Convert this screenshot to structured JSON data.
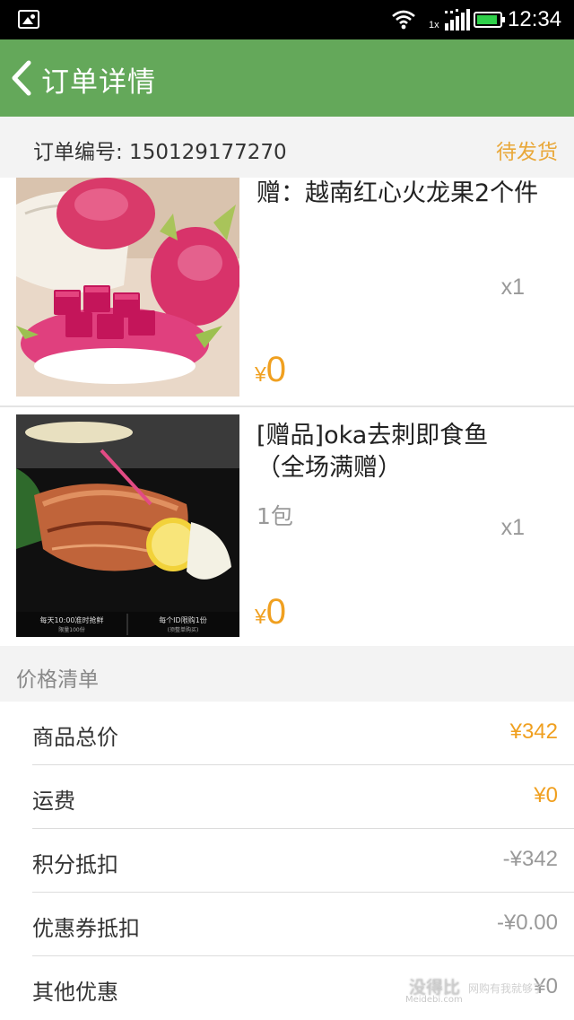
{
  "status_bar": {
    "time": "12:34",
    "network_label": "1x",
    "icons": [
      "image-notification-icon",
      "wifi-icon",
      "signal-icon",
      "battery-icon"
    ]
  },
  "header": {
    "title": "订单详情",
    "back_icon": "chevron-left-icon"
  },
  "order": {
    "number_label": "订单编号: 150129177270",
    "status": "待发货"
  },
  "products": [
    {
      "name": "赠：越南红心火龙果2个件",
      "spec": "",
      "quantity": "x1",
      "currency": "¥",
      "price": "0"
    },
    {
      "name": "[赠品]oka去刺即食鱼（全场满赠）",
      "spec": "1包",
      "quantity": "x1",
      "currency": "¥",
      "price": "0",
      "image_caption_left": "每天10:00准时抢鲜",
      "image_caption_left_sub": "限量100份",
      "image_caption_right": "每个ID限购1份",
      "image_caption_right_sub": "(须整单购买)"
    }
  ],
  "price_list": {
    "title": "价格清单",
    "rows": [
      {
        "label": "商品总价",
        "value": "¥342"
      },
      {
        "label": "运费",
        "value": "¥0"
      },
      {
        "label": "积分抵扣",
        "value": "-¥342"
      },
      {
        "label": "优惠券抵扣",
        "value": "-¥0.00"
      },
      {
        "label": "其他优惠",
        "value": "¥0"
      }
    ]
  },
  "watermark": {
    "brand": "没得比",
    "domain": "Meidebi.com",
    "slogan": "网购有我就够了"
  },
  "colors": {
    "header_bg": "#64a85a",
    "accent_orange": "#f0a020",
    "status_orange": "#e9a83a",
    "section_bg": "#f3f3f3"
  }
}
